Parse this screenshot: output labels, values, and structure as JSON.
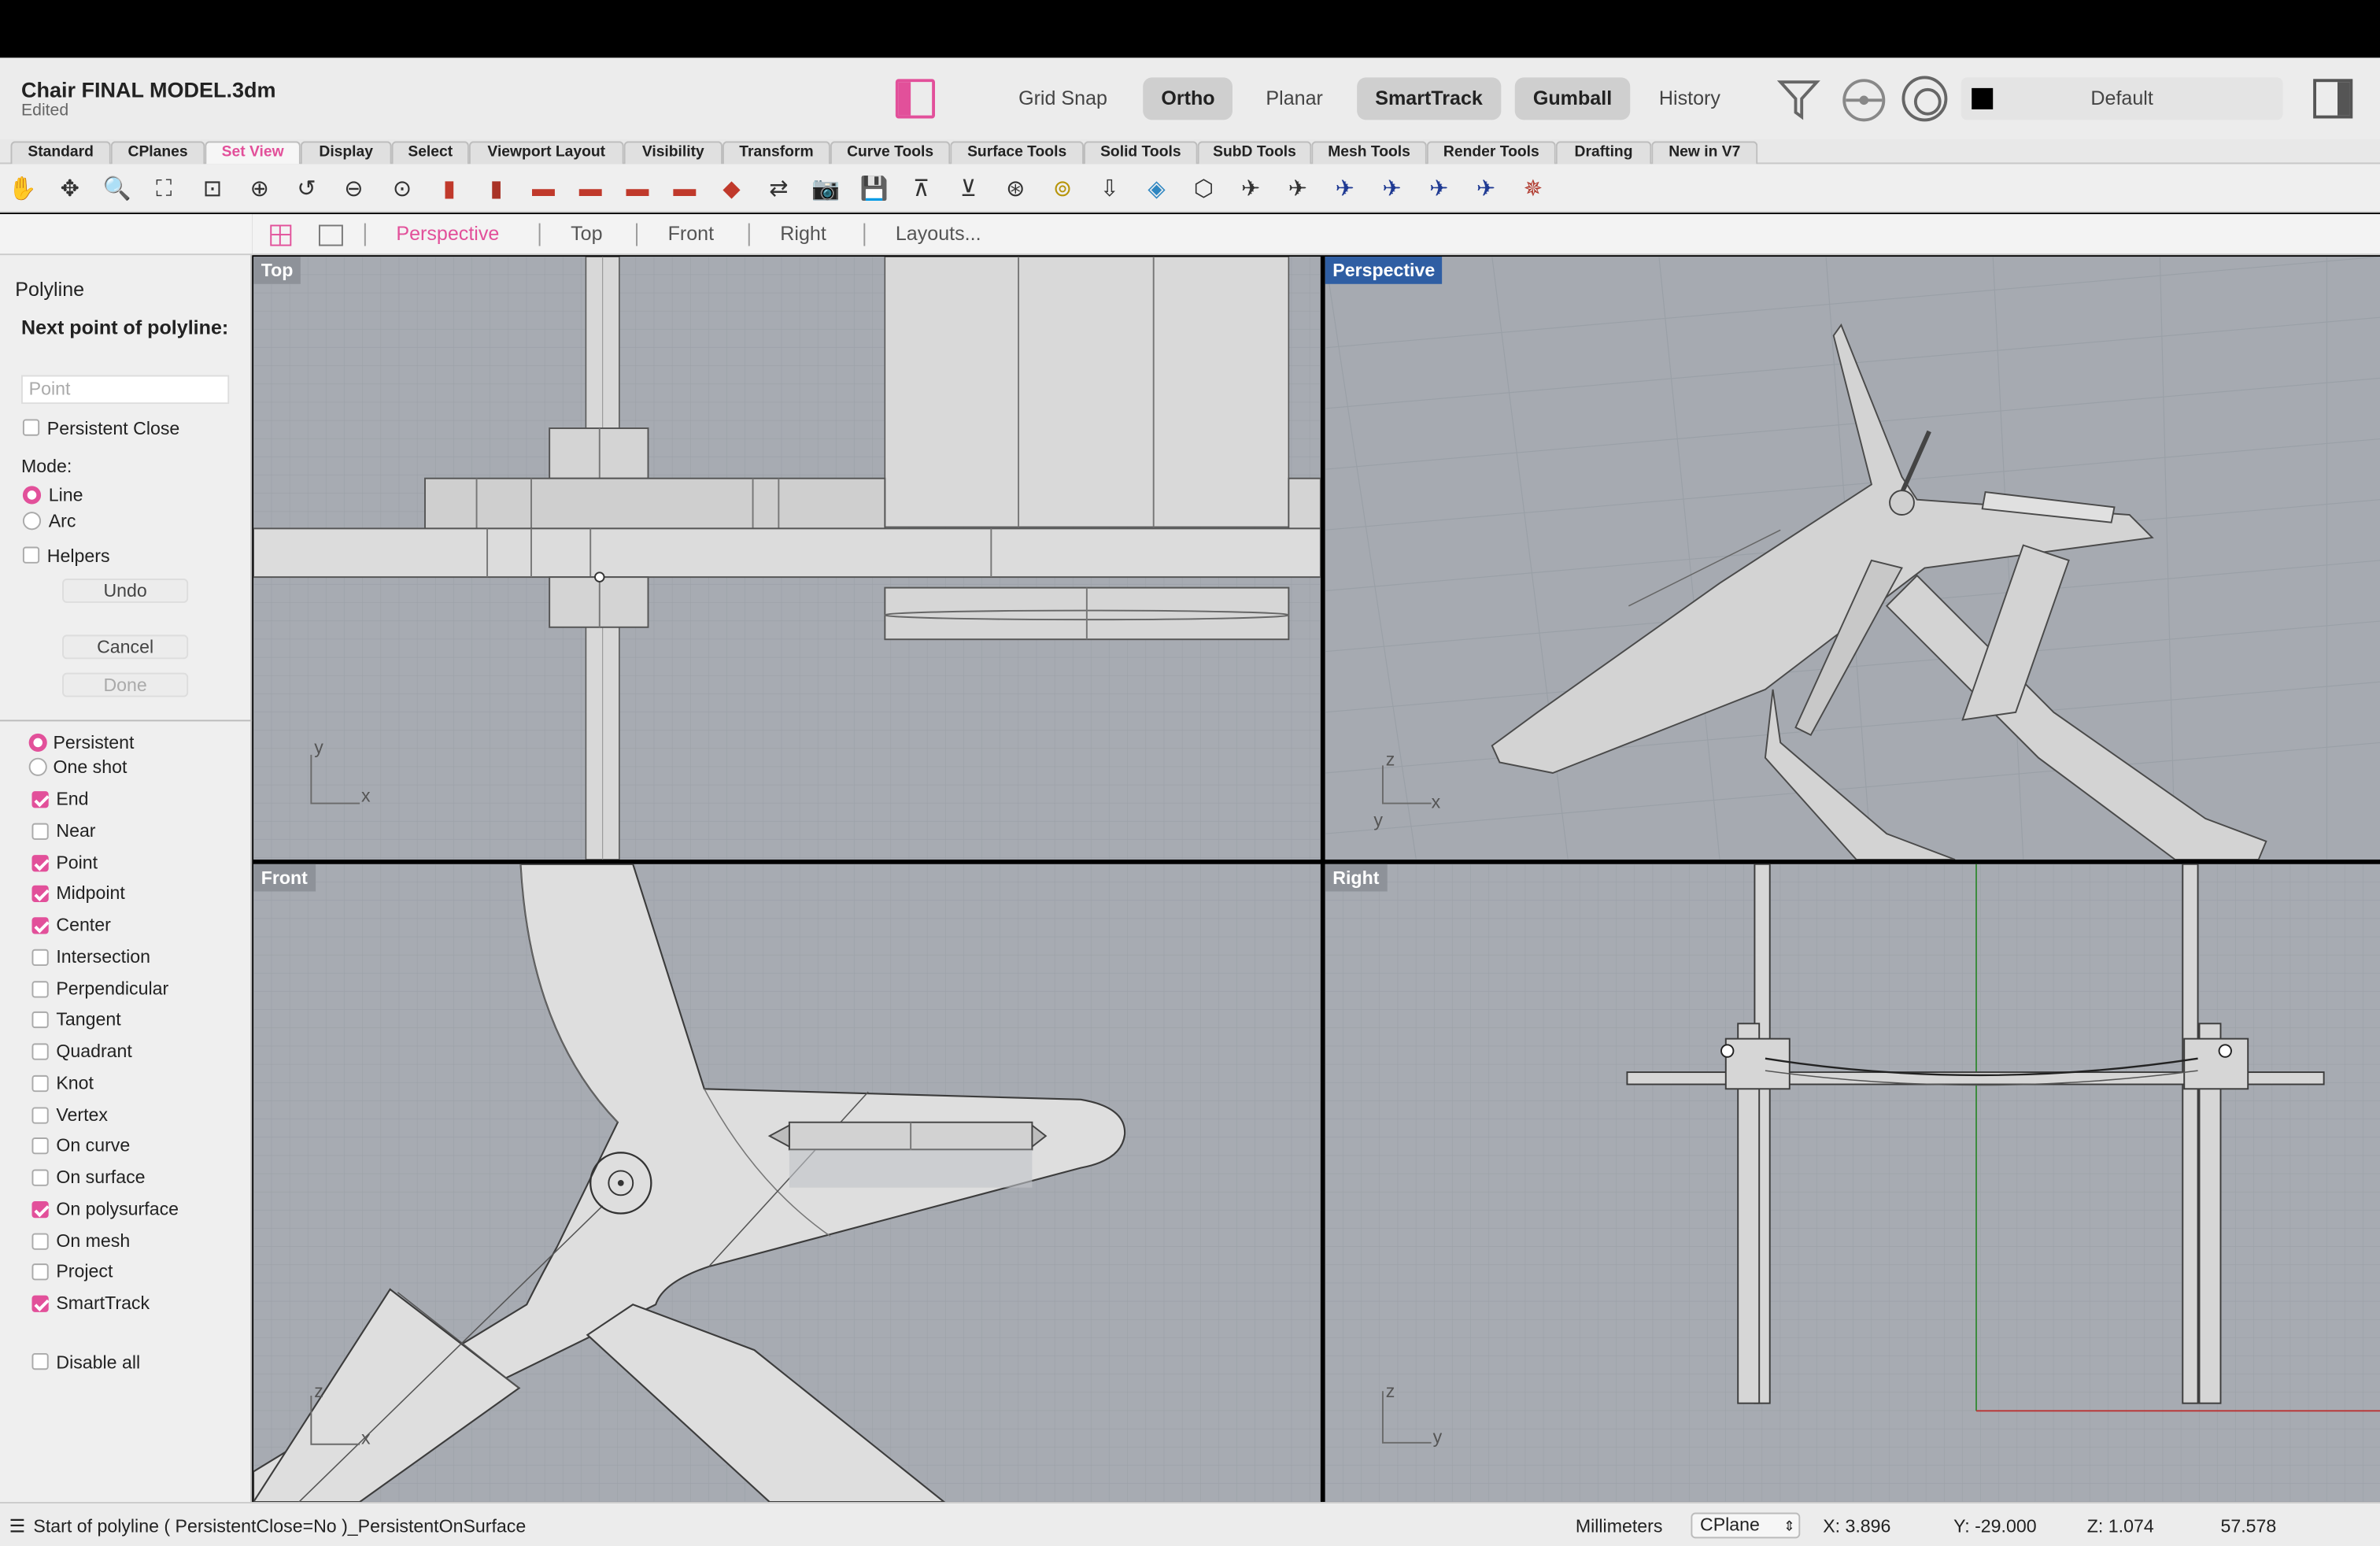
{
  "document": {
    "title": "Chair FINAL MODEL.3dm",
    "status": "Edited"
  },
  "topbar": {
    "grid_snap": "Grid Snap",
    "ortho": "Ortho",
    "planar": "Planar",
    "smarttrack": "SmartTrack",
    "gumball": "Gumball",
    "history": "History",
    "layer": "Default"
  },
  "tabs": [
    "Standard",
    "CPlanes",
    "Set View",
    "Display",
    "Select",
    "Viewport Layout",
    "Visibility",
    "Transform",
    "Curve Tools",
    "Surface Tools",
    "Solid Tools",
    "SubD Tools",
    "Mesh Tools",
    "Render Tools",
    "Drafting",
    "New in V7"
  ],
  "active_tab": "Set View",
  "view_tabs": {
    "perspective": "Perspective",
    "top": "Top",
    "front": "Front",
    "right": "Right",
    "layouts": "Layouts..."
  },
  "command": {
    "name": "Polyline",
    "prompt": "Next point of polyline:",
    "input_placeholder": "Point",
    "persistent_close": "Persistent Close",
    "mode_label": "Mode:",
    "mode_line": "Line",
    "mode_arc": "Arc",
    "helpers": "Helpers",
    "undo": "Undo",
    "cancel": "Cancel",
    "done": "Done"
  },
  "osnap": {
    "persistent": "Persistent",
    "one_shot": "One shot",
    "items": [
      {
        "label": "End",
        "checked": true
      },
      {
        "label": "Near",
        "checked": false
      },
      {
        "label": "Point",
        "checked": true
      },
      {
        "label": "Midpoint",
        "checked": true
      },
      {
        "label": "Center",
        "checked": true
      },
      {
        "label": "Intersection",
        "checked": false
      },
      {
        "label": "Perpendicular",
        "checked": false
      },
      {
        "label": "Tangent",
        "checked": false
      },
      {
        "label": "Quadrant",
        "checked": false
      },
      {
        "label": "Knot",
        "checked": false
      },
      {
        "label": "Vertex",
        "checked": false
      },
      {
        "label": "On curve",
        "checked": false
      },
      {
        "label": "On surface",
        "checked": false
      },
      {
        "label": "On polysurface",
        "checked": true
      },
      {
        "label": "On mesh",
        "checked": false
      },
      {
        "label": "Project",
        "checked": false
      },
      {
        "label": "SmartTrack",
        "checked": true
      }
    ],
    "disable_all": "Disable all"
  },
  "viewports": {
    "top": "Top",
    "perspective": "Perspective",
    "front": "Front",
    "right": "Right",
    "axes": {
      "x": "x",
      "y": "y",
      "z": "z"
    }
  },
  "status": {
    "command_line": "Start of polyline ( PersistentClose=No )_PersistentOnSurface",
    "units": "Millimeters",
    "cplane": "CPlane",
    "x": "X: 3.896",
    "y": "Y: -29.000",
    "z": "Z: 1.074",
    "extra": "57.578"
  },
  "colors": {
    "accent": "#e2509a",
    "viewport_bg": "#a7abb2",
    "active_viewport": "#2f5ea3"
  }
}
